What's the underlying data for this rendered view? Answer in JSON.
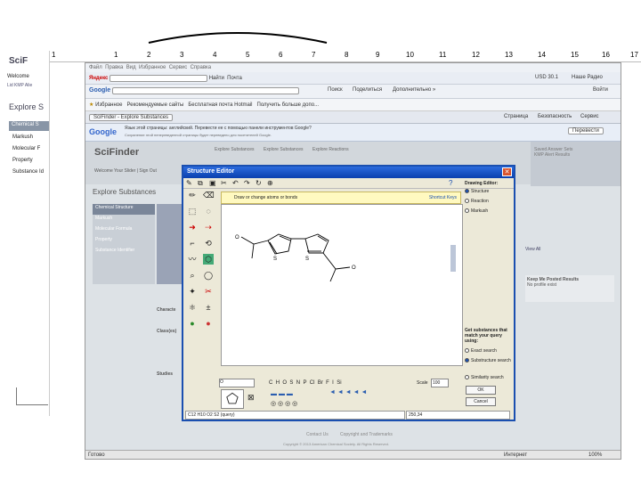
{
  "ruler": {
    "numbers": [
      "1",
      "1",
      "2",
      "3",
      "4",
      "5",
      "6",
      "7",
      "8",
      "9",
      "10",
      "11",
      "12",
      "13",
      "14",
      "15",
      "16",
      "17"
    ]
  },
  "left_doc": {
    "logo": "SciF",
    "welcome": "Welcome",
    "link": "Lid KMP Alie",
    "explore": "Explore S",
    "items": [
      "Chemical S",
      "Markush",
      "Molecular F",
      "Property",
      "Substance Id"
    ]
  },
  "browser": {
    "menu": [
      "Файл",
      "Правка",
      "Вид",
      "Избранное",
      "Сервис",
      "Справка"
    ],
    "toolbar": {
      "yandex": "Яндекс",
      "find": "Найти",
      "mail": "Почта",
      "usd": "USD 30.1",
      "radio": "Наше Радио"
    },
    "google_bar": {
      "label": "Google",
      "search": "Поиск",
      "share": "Поделиться",
      "more": "Дополнительно »",
      "login": "Войти"
    },
    "favorites": {
      "label": "Избранное",
      "items": [
        "Рекомендуемые сайты",
        "Бесплатная почта Hotmail",
        "Получить больше допо..."
      ]
    },
    "tab_title": "SciFinder - Explore Substances",
    "tab_menu": [
      "Страница",
      "Безопасность",
      "Сервис"
    ],
    "translate": {
      "logo": "Google",
      "text": "Язык этой страницы: английский. Перевести ее с помощью панели инструментов Google?",
      "sub": "Сохранение этой непереведенной страницы будет переведено для посетителей Google.",
      "button": "Перевести"
    },
    "page": {
      "logo": "SciFinder",
      "nav": [
        "Explore Substances",
        "Explore Substances",
        "Explore Reactions"
      ],
      "welcome": "Welcome Your Slider | Sign Out",
      "explore_title": "Explore Substances",
      "left_items": [
        "Chemical Structure",
        "Markush",
        "Molecular Formula",
        "Property",
        "Substance Identifier"
      ],
      "labels": [
        "Characte",
        "Class(es)",
        "Studies"
      ],
      "right_panel": {
        "title": "Saved Answer Sets",
        "sub": "KMP Alert Results",
        "link1": "View All",
        "box_title": "Keep Me Posted Results",
        "box_text": "No profile exist"
      },
      "footer": [
        "Contact Us",
        "Copyright and Trademarks"
      ],
      "copyright": "Copyright © 2013 American Chemical Society. All Rights Reserved."
    },
    "status": {
      "left": "Готово",
      "zone": "Интернет",
      "zoom": "100%"
    }
  },
  "dialog": {
    "title": "Structure Editor",
    "hint": "Draw or change atoms or bonds",
    "shortcut": "Shortcut Keys",
    "modes_title": "Drawing Editor:",
    "modes": [
      "Structure",
      "Reaction",
      "Markush"
    ],
    "match_title": "Get substances that match your query using:",
    "match": [
      "Exact search",
      "Substructure search",
      "Similarity search"
    ],
    "elements": [
      "C",
      "H",
      "O",
      "S",
      "N",
      "P",
      "Cl",
      "Br",
      "F",
      "I",
      "Si"
    ],
    "scale_label": "Scale",
    "scale_value": "100",
    "ok": "OK",
    "cancel": "Cancel",
    "formula": "C12 H10 O2 S2 (query)",
    "coords": "250,34"
  }
}
